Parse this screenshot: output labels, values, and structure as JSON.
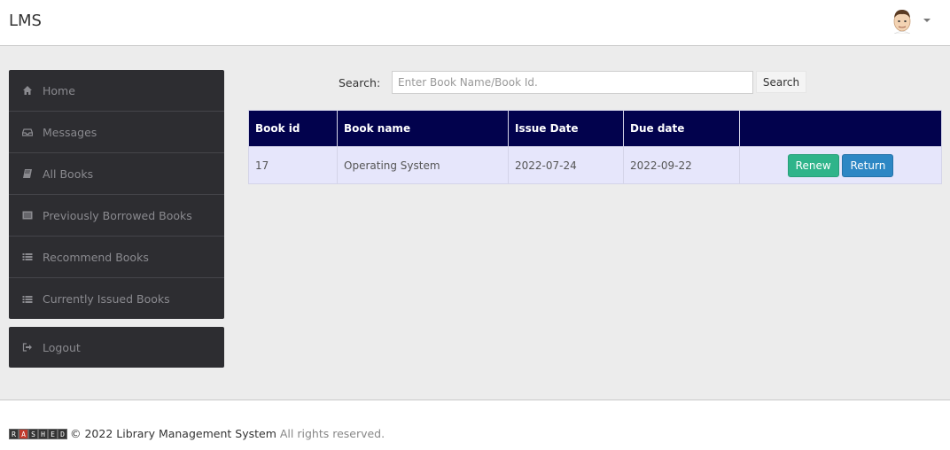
{
  "header": {
    "brand": "LMS"
  },
  "sidebar": {
    "items": [
      {
        "label": "Home",
        "icon": "home-icon"
      },
      {
        "label": "Messages",
        "icon": "inbox-icon"
      },
      {
        "label": "All Books",
        "icon": "book-icon"
      },
      {
        "label": "Previously Borrowed Books",
        "icon": "list-alt-icon"
      },
      {
        "label": "Recommend Books",
        "icon": "list-icon"
      },
      {
        "label": "Currently Issued Books",
        "icon": "list-icon"
      }
    ],
    "logout": "Logout"
  },
  "search": {
    "label": "Search:",
    "placeholder": "Enter Book Name/Book Id.",
    "button": "Search"
  },
  "table": {
    "headers": [
      "Book id",
      "Book name",
      "Issue Date",
      "Due date",
      ""
    ],
    "rows": [
      {
        "id": "17",
        "name": "Operating System",
        "issue_date": "2022-07-24",
        "due_date": "2022-09-22",
        "renew": "Renew",
        "return": "Return"
      }
    ]
  },
  "footer": {
    "logo_letters": [
      "R",
      "A",
      "S",
      "H",
      "E",
      "D"
    ],
    "copyright": "© 2022 Library Management System",
    "rights": "All rights reserved."
  },
  "colors": {
    "table_header": "#02024d",
    "row_bg": "#e6e6fb",
    "renew": "#2fb48a",
    "return": "#2d87c4",
    "sidebar": "#2d2d31"
  }
}
